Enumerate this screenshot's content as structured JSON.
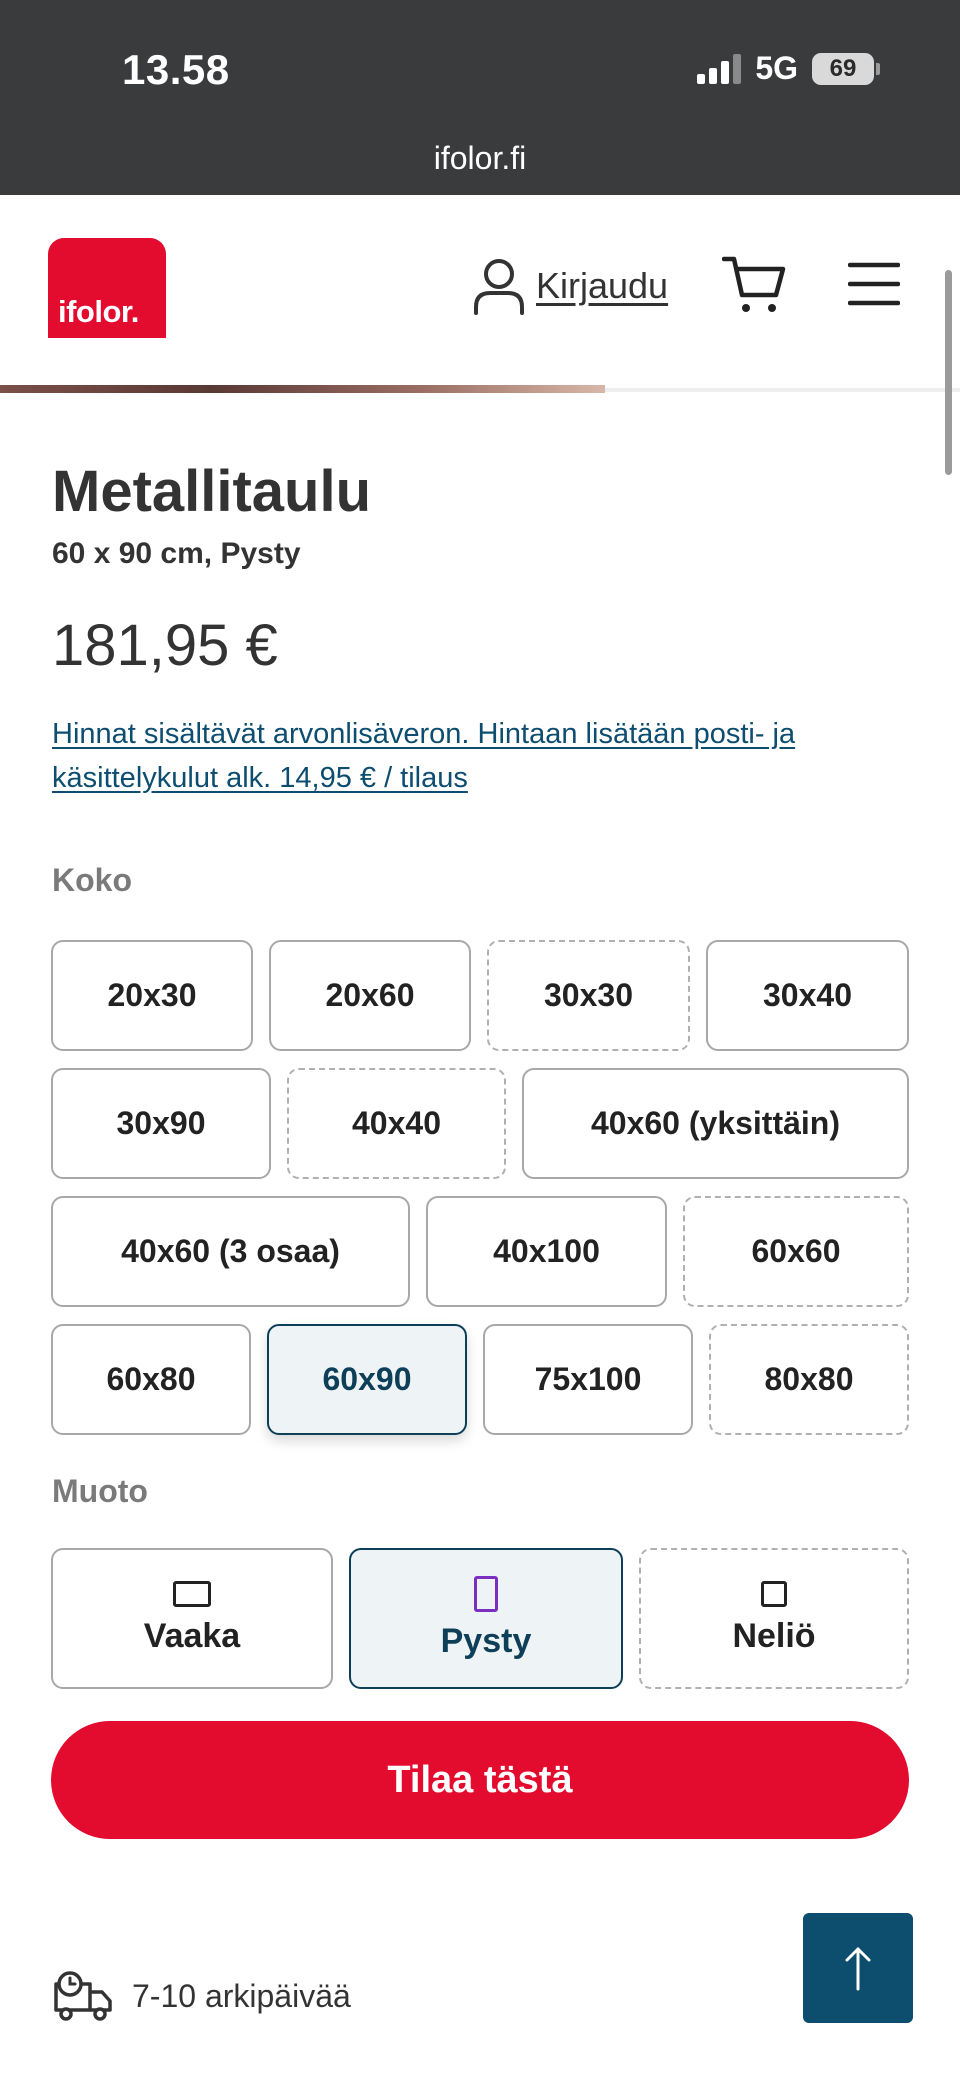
{
  "status_bar": {
    "time": "13.58",
    "network": "5G",
    "battery": "69",
    "url": "ifolor.fi"
  },
  "header": {
    "logo_text": "ifolor.",
    "login_label": "Kirjaudu"
  },
  "product": {
    "title": "Metallitaulu",
    "subtitle": "60 x 90 cm, Pysty",
    "price": "181,95 €",
    "vat_note": "Hinnat sisältävät arvonlisäveron. Hintaan lisätään posti- ja käsittelykulut alk. 14,95 € / tilaus"
  },
  "size": {
    "label": "Koko",
    "options": [
      {
        "label": "20x30",
        "state": "available"
      },
      {
        "label": "20x60",
        "state": "available"
      },
      {
        "label": "30x30",
        "state": "unavailable"
      },
      {
        "label": "30x40",
        "state": "available"
      },
      {
        "label": "30x90",
        "state": "available"
      },
      {
        "label": "40x40",
        "state": "unavailable"
      },
      {
        "label": "40x60 (yksittäin)",
        "state": "available"
      },
      {
        "label": "40x60 (3 osaa)",
        "state": "available"
      },
      {
        "label": "40x100",
        "state": "available"
      },
      {
        "label": "60x60",
        "state": "unavailable"
      },
      {
        "label": "60x80",
        "state": "available"
      },
      {
        "label": "60x90",
        "state": "selected"
      },
      {
        "label": "75x100",
        "state": "available"
      },
      {
        "label": "80x80",
        "state": "unavailable"
      }
    ]
  },
  "shape": {
    "label": "Muoto",
    "options": [
      {
        "label": "Vaaka",
        "icon": "landscape-rectangle-icon",
        "state": "available"
      },
      {
        "label": "Pysty",
        "icon": "portrait-rectangle-icon",
        "state": "selected"
      },
      {
        "label": "Neliö",
        "icon": "square-icon",
        "state": "unavailable"
      }
    ]
  },
  "order_button": "Tilaa tästä",
  "delivery": {
    "text": "7-10 arkipäivää",
    "icon": "delivery-truck-clock-icon"
  },
  "colors": {
    "brand_red": "#e30b2e",
    "selected_border": "#0d3f58",
    "link_blue": "#0d4d70",
    "selected_icon": "#7a2fc0"
  }
}
